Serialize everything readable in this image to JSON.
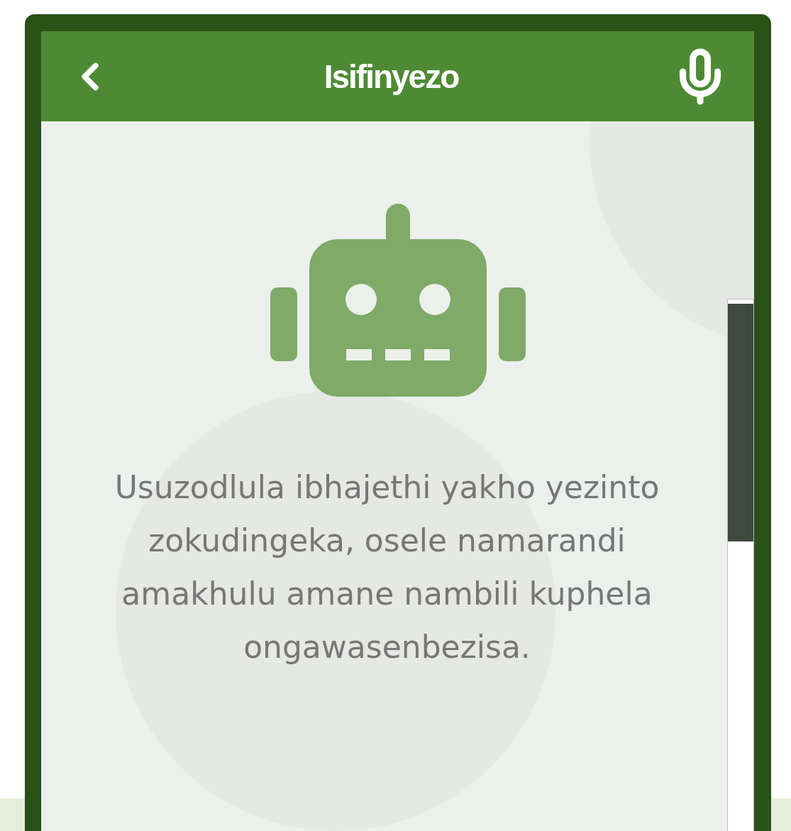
{
  "header": {
    "title": "Isifinyezo"
  },
  "message": "Usuzodlula ibhajethi yakho yezinto zokudingeka, osele namarandi amakhulu amane nambili kuphela ongawasenbezisa."
}
